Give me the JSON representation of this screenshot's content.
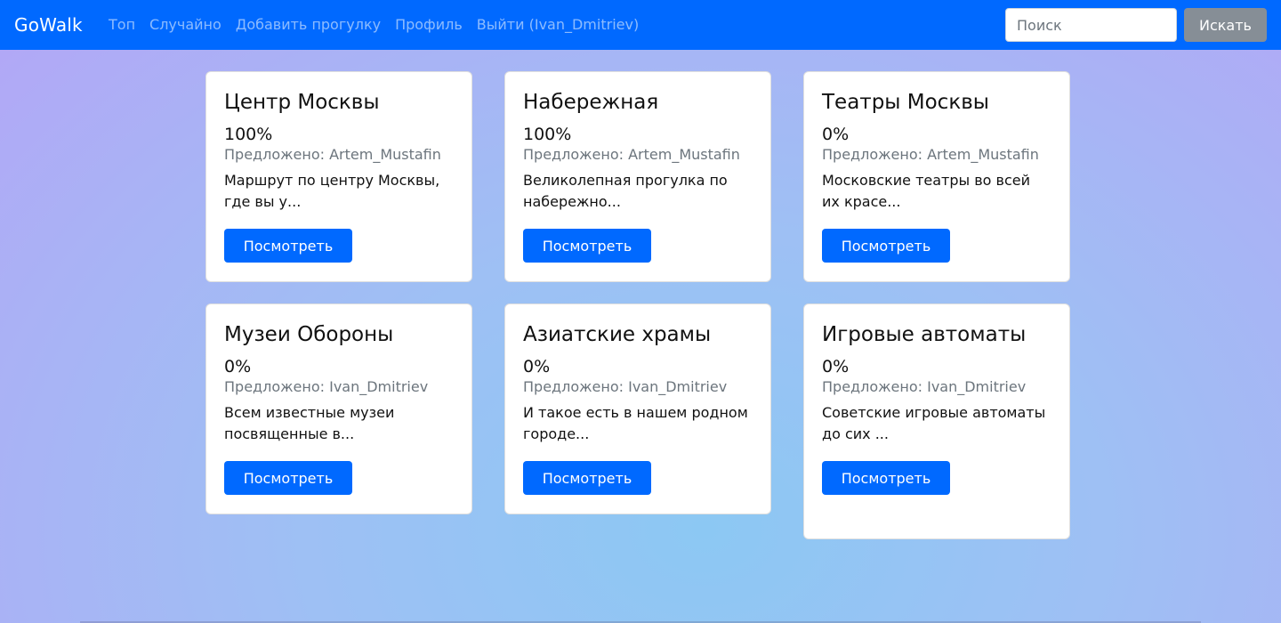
{
  "navbar": {
    "brand": "GoWalk",
    "links": [
      "Топ",
      "Случайно",
      "Добавить прогулку",
      "Профиль",
      "Выйти (Ivan_Dmitriev)"
    ],
    "search_placeholder": "Поиск",
    "search_button": "Искать"
  },
  "cards": [
    {
      "title": "Центр Москвы",
      "percent": "100%",
      "author": "Предложено: Artem_Mustafin",
      "description": "Маршрут по центру Москвы, где вы у...",
      "button": "Посмотреть"
    },
    {
      "title": "Набережная",
      "percent": "100%",
      "author": "Предложено: Artem_Mustafin",
      "description": "Великолепная прогулка по набережно...",
      "button": "Посмотреть"
    },
    {
      "title": "Театры Москвы",
      "percent": "0%",
      "author": "Предложено: Artem_Mustafin",
      "description": "Московские театры во всей их красе...",
      "button": "Посмотреть"
    },
    {
      "title": "Музеи Обороны",
      "percent": "0%",
      "author": "Предложено: Ivan_Dmitriev",
      "description": "Всем известные музеи посвященные в...",
      "button": "Посмотреть"
    },
    {
      "title": "Азиатские храмы",
      "percent": "0%",
      "author": "Предложено: Ivan_Dmitriev",
      "description": "И такое есть в нашем родном городе...",
      "button": "Посмотреть"
    },
    {
      "title": "Игровые автоматы",
      "percent": "0%",
      "author": "Предложено: Ivan_Dmitriev",
      "description": "Советские игровые автоматы до сих ...",
      "button": "Посмотреть"
    }
  ],
  "colors": {
    "navbar_bg": "#0069ff",
    "primary_button": "#0069ff",
    "search_button": "#868e96"
  }
}
